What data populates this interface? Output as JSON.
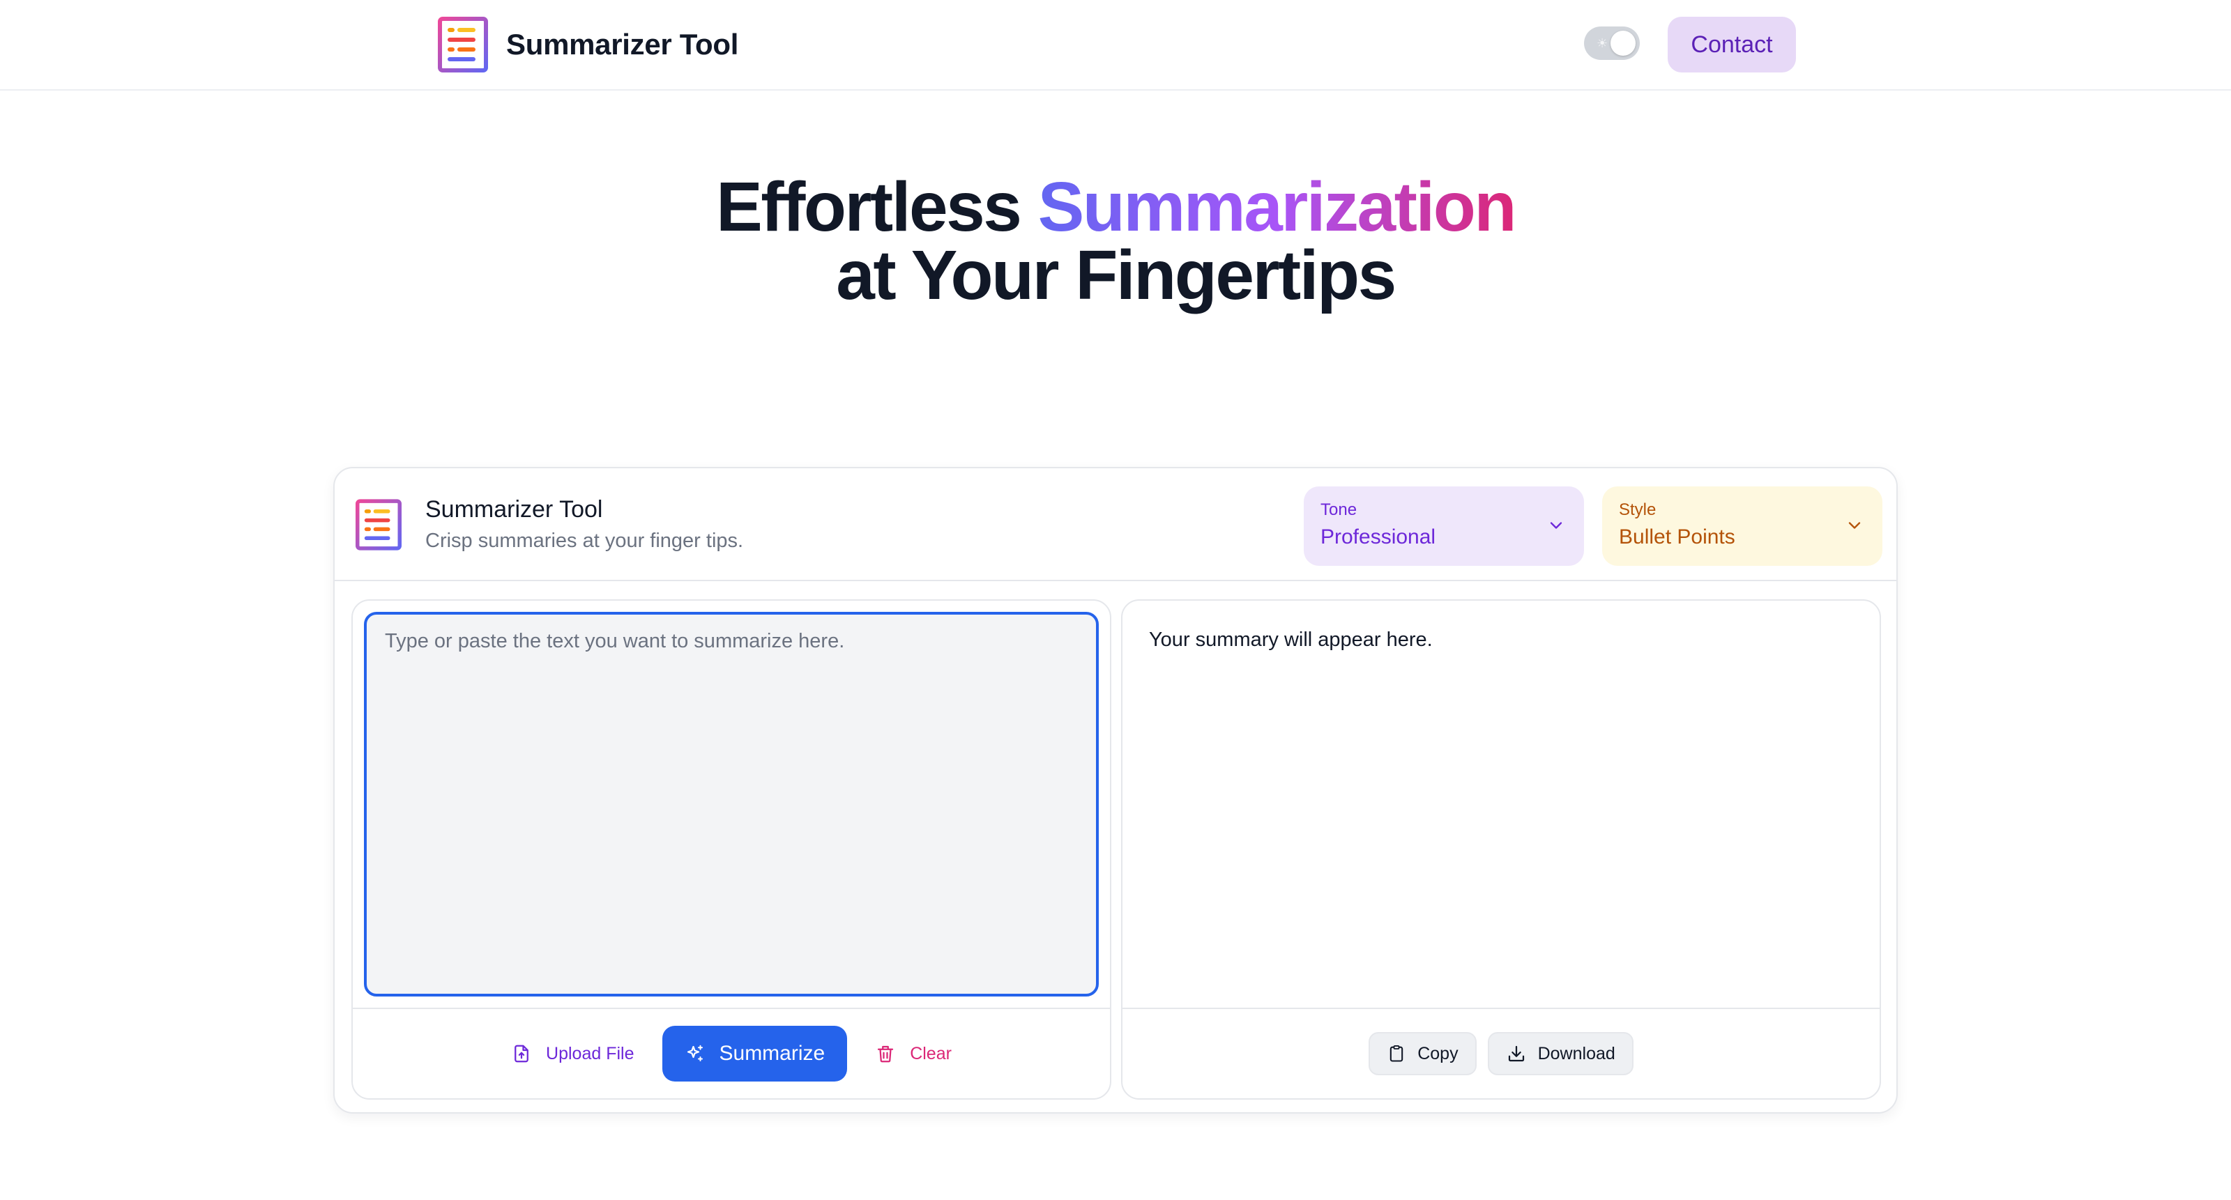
{
  "nav": {
    "brand_title": "Summarizer Tool",
    "contact_label": "Contact"
  },
  "hero": {
    "line1_plain": "Effortless ",
    "line1_highlight": "Summarization",
    "line2": "at Your Fingertips"
  },
  "card": {
    "title": "Summarizer Tool",
    "subtitle": "Crisp summaries at your finger tips.",
    "tone": {
      "label": "Tone",
      "value": "Professional"
    },
    "style": {
      "label": "Style",
      "value": "Bullet Points"
    }
  },
  "input": {
    "placeholder": "Type or paste the text you want to summarize here.",
    "upload_label": "Upload File",
    "summarize_label": "Summarize",
    "clear_label": "Clear"
  },
  "output": {
    "placeholder_text": "Your summary will appear here.",
    "copy_label": "Copy",
    "download_label": "Download"
  },
  "colors": {
    "primary": "#2563eb",
    "accent_purple": "#6d28d9",
    "accent_pink": "#db2777",
    "tone_bg": "#efe7fb",
    "style_bg": "#fef8df",
    "contact_bg": "#e7d9f7"
  },
  "icons": [
    "logo-icon",
    "sun-icon",
    "chevron-down-icon",
    "upload-file-icon",
    "sparkles-icon",
    "trash-icon",
    "clipboard-icon",
    "download-icon"
  ]
}
